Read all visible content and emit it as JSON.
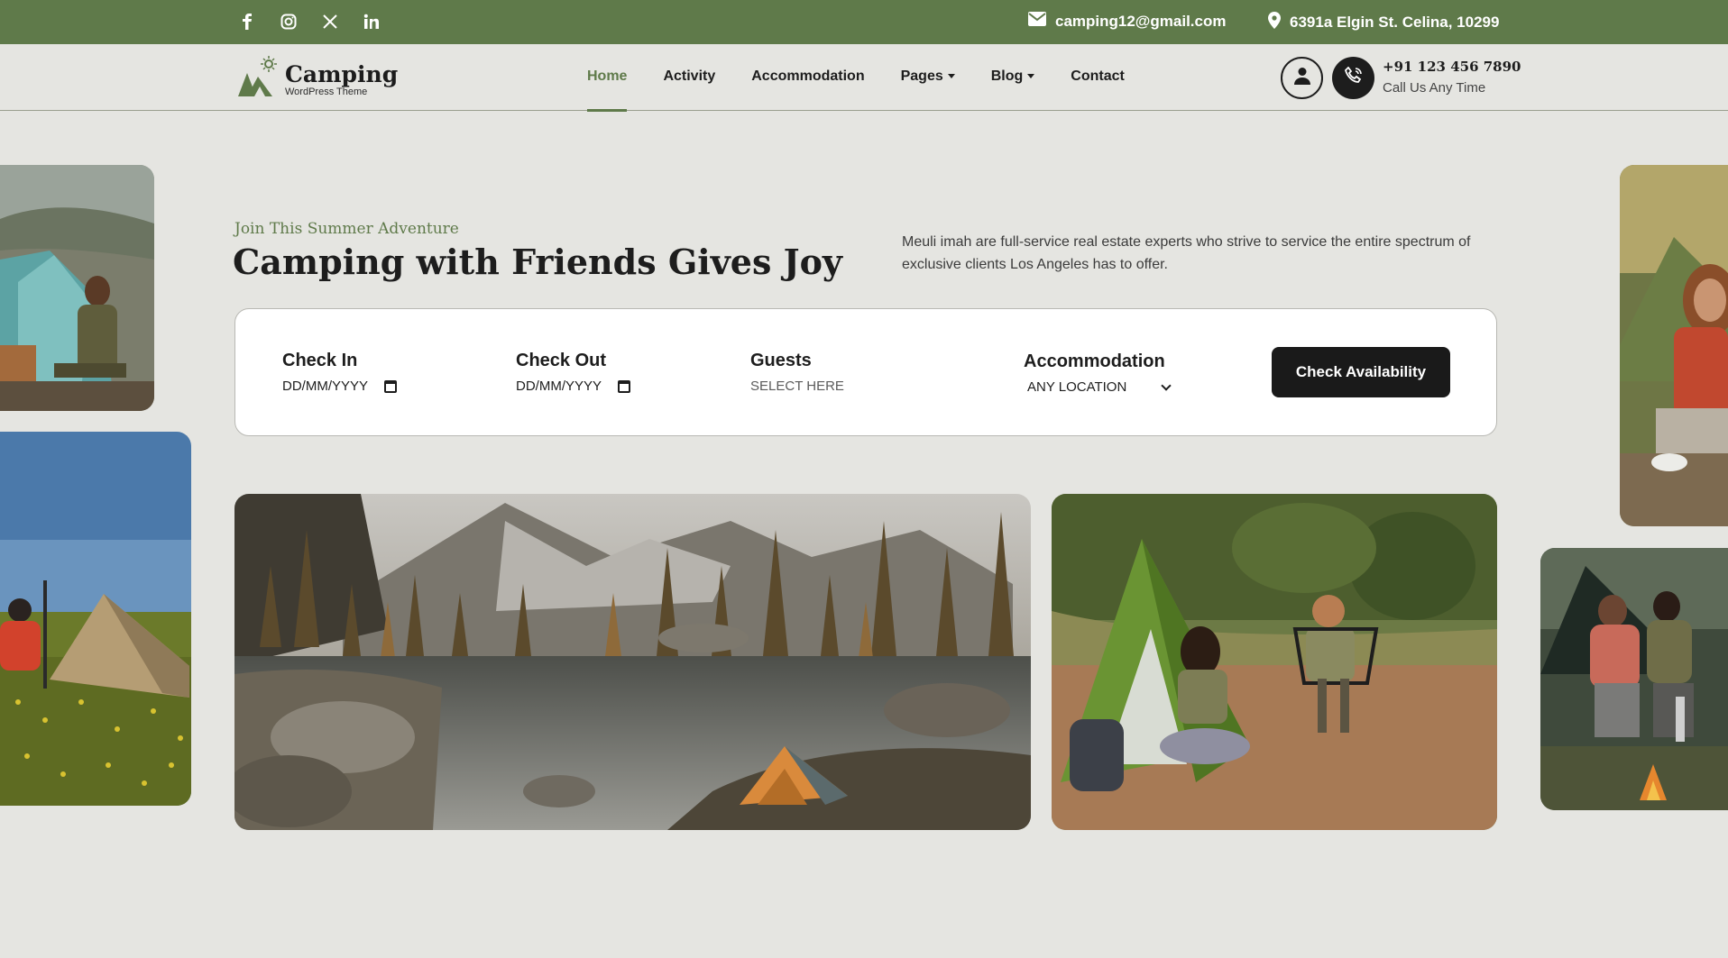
{
  "topbar": {
    "social": [
      "facebook-icon",
      "instagram-icon",
      "x-icon",
      "linkedin-icon"
    ],
    "email": "camping12@gmail.com",
    "address": "6391a Elgin St. Celina, 10299"
  },
  "header": {
    "logo_title": "Camping",
    "logo_sub": "WordPress Theme",
    "nav": [
      "Home",
      "Activity",
      "Accommodation",
      "Pages",
      "Blog",
      "Contact"
    ],
    "phone": "+91 123 456 7890",
    "phone_sub": "Call Us Any Time"
  },
  "hero": {
    "kicker": "Join This Summer Adventure",
    "title": "Camping with Friends Gives Joy",
    "description": "Meuli imah are full-service real estate experts who strive to service the entire spectrum of exclusive clients Los Angeles has to offer."
  },
  "booking": {
    "check_in_label": "Check In",
    "check_in_placeholder": "DD/MM/YYYY",
    "check_out_label": "Check Out",
    "check_out_placeholder": "DD/MM/YYYY",
    "guests_label": "Guests",
    "guests_placeholder": "SELECT HERE",
    "accommodation_label": "Accommodation",
    "accommodation_value": "ANY LOCATION",
    "button": "Check Availability"
  },
  "colors": {
    "brand_green": "#5f7a4a",
    "dark": "#1a1a1a",
    "background": "#e5e5e1"
  }
}
